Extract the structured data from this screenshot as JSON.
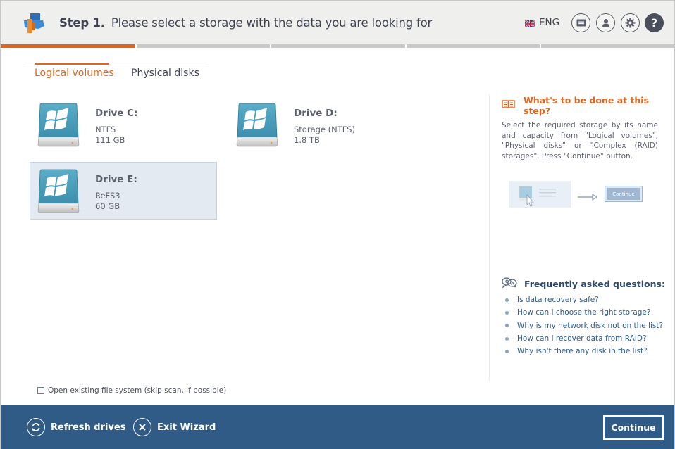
{
  "header": {
    "step_label": "Step 1.",
    "title": "Please select a storage with the data you are looking for",
    "language": "ENG",
    "icons": [
      "flag-uk-icon",
      "messages-icon",
      "user-icon",
      "gear-icon",
      "help-icon"
    ],
    "help_glyph": "?"
  },
  "progress": {
    "current_step": 1,
    "total_steps": 5,
    "accent_color": "#e0661f"
  },
  "tabs": [
    {
      "label": "Logical volumes",
      "active": true
    },
    {
      "label": "Physical disks",
      "active": false
    }
  ],
  "drives": [
    {
      "name": "Drive C:",
      "fs": "NTFS",
      "size": "111 GB",
      "selected": false
    },
    {
      "name": "Drive D:",
      "fs": "Storage (NTFS)",
      "size": "1.8 TB",
      "selected": false
    },
    {
      "name": "Drive E:",
      "fs": "ReFS3",
      "size": "60 GB",
      "selected": true
    }
  ],
  "help": {
    "title": "What's to be done at this step?",
    "text": "Select the required storage by its name and capacity from \"Logical volumes\", \"Physical disks\" or \"Complex (RAID) storages\". Press \"Continue\" button.",
    "illustration_button": "Continue"
  },
  "faq": {
    "title": "Frequently asked questions:",
    "items": [
      "Is data recovery safe?",
      "How can I choose the right storage?",
      "Why is my network disk not on the list?",
      "How can I recover data from RAID?",
      "Why isn't there any disk in the list?"
    ]
  },
  "options": {
    "open_fs_label": "Open existing file system (skip scan, if possible)",
    "open_fs_checked": false
  },
  "footer": {
    "refresh_label": "Refresh drives",
    "exit_label": "Exit Wizard",
    "continue_label": "Continue",
    "background_color": "#2f5b86"
  }
}
